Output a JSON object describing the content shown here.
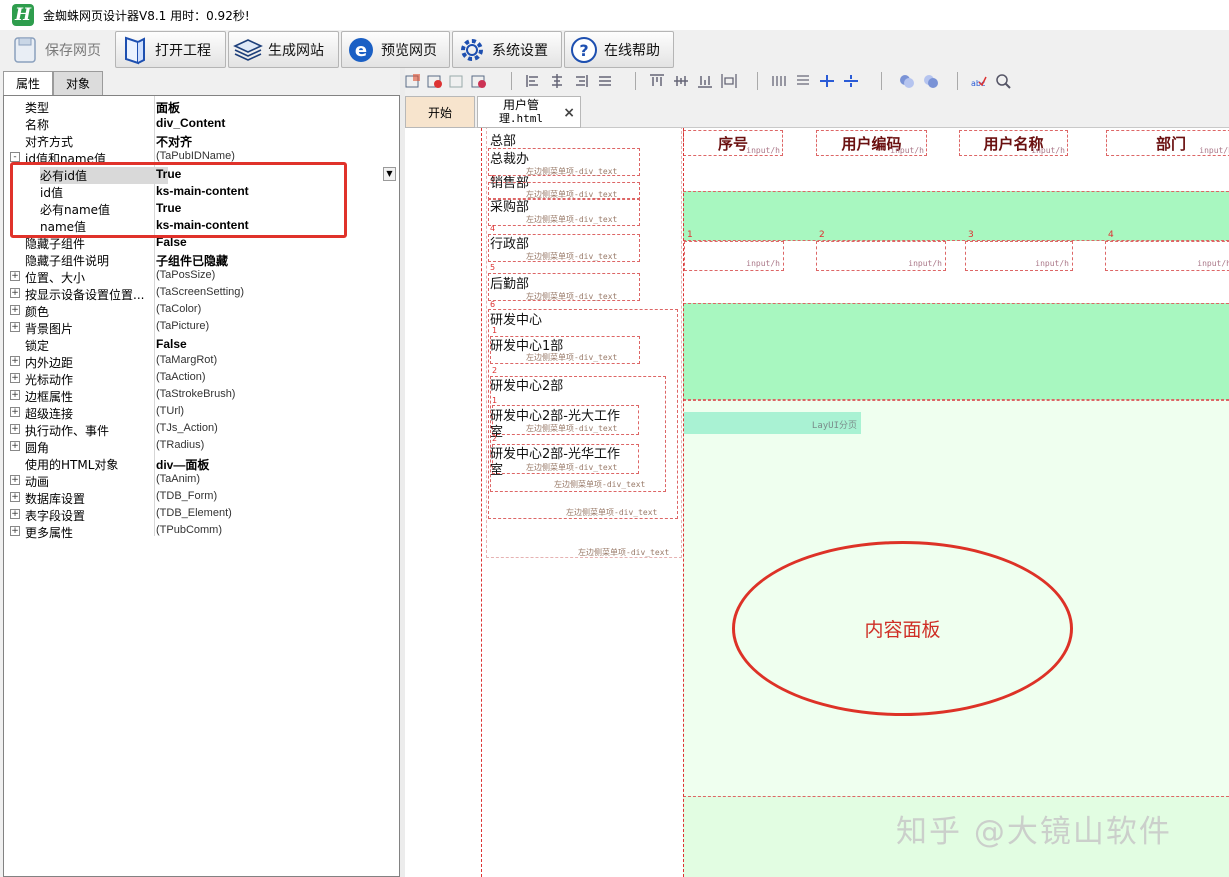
{
  "window": {
    "title": "金蜘蛛网页设计器V8.1 用时：0.92秒!",
    "logo_letter": "H"
  },
  "toolbar": {
    "save": "保存网页",
    "open": "打开工程",
    "generate": "生成网站",
    "preview": "预览网页",
    "settings": "系统设置",
    "help": "在线帮助"
  },
  "left_tabs": {
    "properties": "属性",
    "objects": "对象"
  },
  "properties": [
    {
      "name": "类型",
      "value": "面板",
      "bold": true
    },
    {
      "name": "名称",
      "value": "div_Content",
      "bold": true
    },
    {
      "name": "对齐方式",
      "value": "不对齐",
      "bold": true
    },
    {
      "name": "id值和name值",
      "value": "(TaPubIDName)",
      "expander": "-"
    },
    {
      "name": "必有id值",
      "value": "True",
      "bold": true,
      "sub": true
    },
    {
      "name": "id值",
      "value": "ks-main-content",
      "bold": true,
      "sub": true
    },
    {
      "name": "必有name值",
      "value": "True",
      "bold": true,
      "sub": true
    },
    {
      "name": "name值",
      "value": "ks-main-content",
      "bold": true,
      "sub": true
    },
    {
      "name": "隐藏子组件",
      "value": "False",
      "bold": true
    },
    {
      "name": "隐藏子组件说明",
      "value": "子组件已隐藏",
      "bold": true
    },
    {
      "name": "位置、大小",
      "value": "(TaPosSize)",
      "expander": "+"
    },
    {
      "name": "按显示设备设置位置...",
      "value": "(TaScreenSetting)",
      "expander": "+"
    },
    {
      "name": "颜色",
      "value": "(TaColor)",
      "expander": "+"
    },
    {
      "name": "背景图片",
      "value": "(TaPicture)",
      "expander": "+"
    },
    {
      "name": "锁定",
      "value": "False",
      "bold": true
    },
    {
      "name": "内外边距",
      "value": "(TaMargRot)",
      "expander": "+"
    },
    {
      "name": "光标动作",
      "value": "(TaAction)",
      "expander": "+"
    },
    {
      "name": "边框属性",
      "value": "(TaStrokeBrush)",
      "expander": "+"
    },
    {
      "name": "超级连接",
      "value": "(TUrl)",
      "expander": "+"
    },
    {
      "name": "执行动作、事件",
      "value": "(TJs_Action)",
      "expander": "+"
    },
    {
      "name": "圆角",
      "value": "(TRadius)",
      "expander": "+"
    },
    {
      "name": "使用的HTML对象",
      "value": "div—面板",
      "bold": true
    },
    {
      "name": "动画",
      "value": "(TaAnim)",
      "expander": "+"
    },
    {
      "name": "数据库设置",
      "value": "(TDB_Form)",
      "expander": "+"
    },
    {
      "name": "表字段设置",
      "value": "(TDB_Element)",
      "expander": "+"
    },
    {
      "name": "更多属性",
      "value": "(TPubComm)",
      "expander": "+"
    }
  ],
  "editor_tabs": {
    "start": "开始",
    "file_line1": "用户管",
    "file_line2": "理.html",
    "close": "×"
  },
  "menu": {
    "items": [
      "总部",
      "总裁办",
      "销售部",
      "采购部",
      "行政部",
      "后勤部",
      "研发中心",
      "研发中心1部",
      "研发中心2部",
      "研发中心2部-光大工作",
      "室",
      "研发中心2部-光华工作",
      "室"
    ],
    "caption": "左边侧菜单项-div_text",
    "numbers": [
      "3",
      "4",
      "5",
      "6",
      "1",
      "2",
      "1",
      "2"
    ]
  },
  "table": {
    "headers": [
      "序号",
      "用户编码",
      "用户名称",
      "部门"
    ],
    "input_hint": "input/h",
    "row_numbers": [
      "1",
      "2",
      "3",
      "4"
    ],
    "band_number": "2"
  },
  "pagination": "LayUI分页",
  "annotation": "内容面板",
  "watermark": "知乎 @大镜山软件"
}
